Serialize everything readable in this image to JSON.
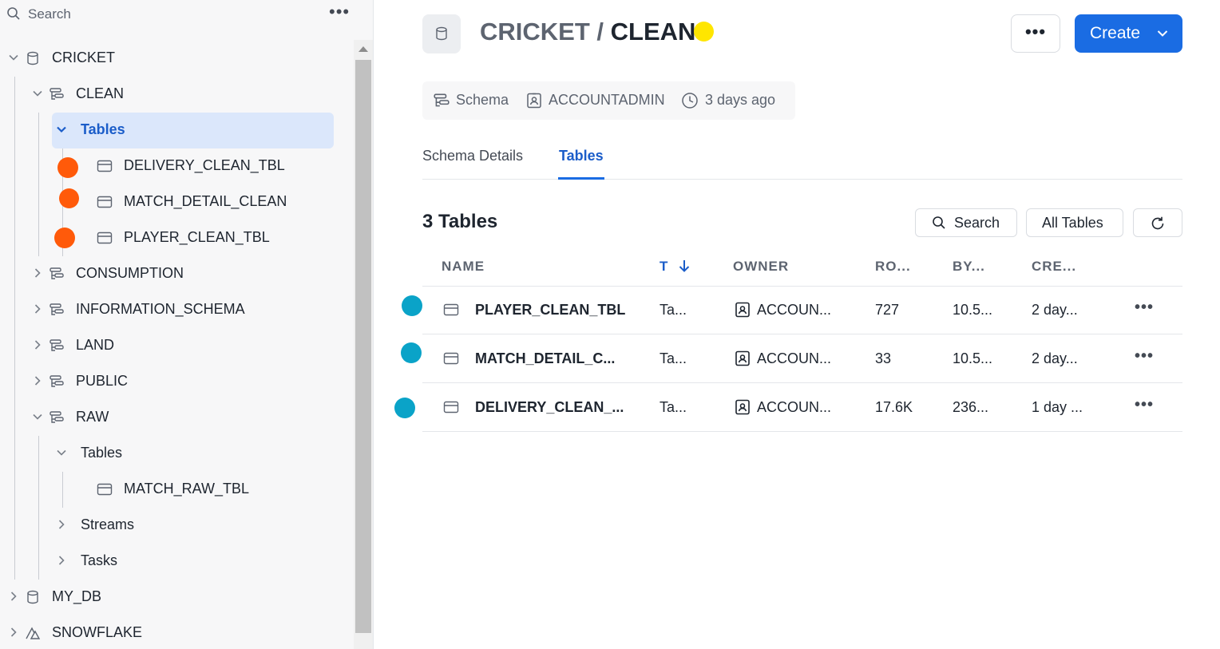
{
  "sidebar": {
    "search_placeholder": "Search",
    "tree": {
      "cricket": "CRICKET",
      "clean": "CLEAN",
      "clean_tables": "Tables",
      "delivery_clean_tbl": "DELIVERY_CLEAN_TBL",
      "match_detail_clean": "MATCH_DETAIL_CLEAN",
      "player_clean_tbl": "PLAYER_CLEAN_TBL",
      "consumption": "CONSUMPTION",
      "information_schema": "INFORMATION_SCHEMA",
      "land": "LAND",
      "public": "PUBLIC",
      "raw": "RAW",
      "raw_tables": "Tables",
      "match_raw_tbl": "MATCH_RAW_TBL",
      "streams": "Streams",
      "tasks": "Tasks",
      "my_db": "MY_DB",
      "snowflake": "SNOWFLAKE"
    }
  },
  "header": {
    "database": "CRICKET",
    "separator": "/",
    "schema": "CLEAN",
    "create_label": "Create"
  },
  "meta": {
    "type": "Schema",
    "owner": "ACCOUNTADMIN",
    "created": "3 days ago"
  },
  "tabs": [
    {
      "label": "Schema Details",
      "active": false
    },
    {
      "label": "Tables",
      "active": true
    }
  ],
  "tables_section": {
    "count_label": "3 Tables",
    "search_label": "Search",
    "filter_label": "All Tables",
    "columns": [
      "NAME",
      "T",
      "OWNER",
      "RO...",
      "BY...",
      "CRE..."
    ],
    "rows": [
      {
        "name": "PLAYER_CLEAN_TBL",
        "type": "Ta...",
        "owner": "ACCOUN...",
        "rows": "727",
        "bytes": "10.5...",
        "created": "2 day..."
      },
      {
        "name": "MATCH_DETAIL_C...",
        "type": "Ta...",
        "owner": "ACCOUN...",
        "rows": "33",
        "bytes": "10.5...",
        "created": "2 day..."
      },
      {
        "name": "DELIVERY_CLEAN_...",
        "type": "Ta...",
        "owner": "ACCOUN...",
        "rows": "17.6K",
        "bytes": "236...",
        "created": "1 day ..."
      }
    ]
  },
  "colors": {
    "accent": "#1a6ce3",
    "marker_orange": "#ff5a0a",
    "marker_teal": "#0aa3c8",
    "marker_yellow": "#ffe600"
  }
}
